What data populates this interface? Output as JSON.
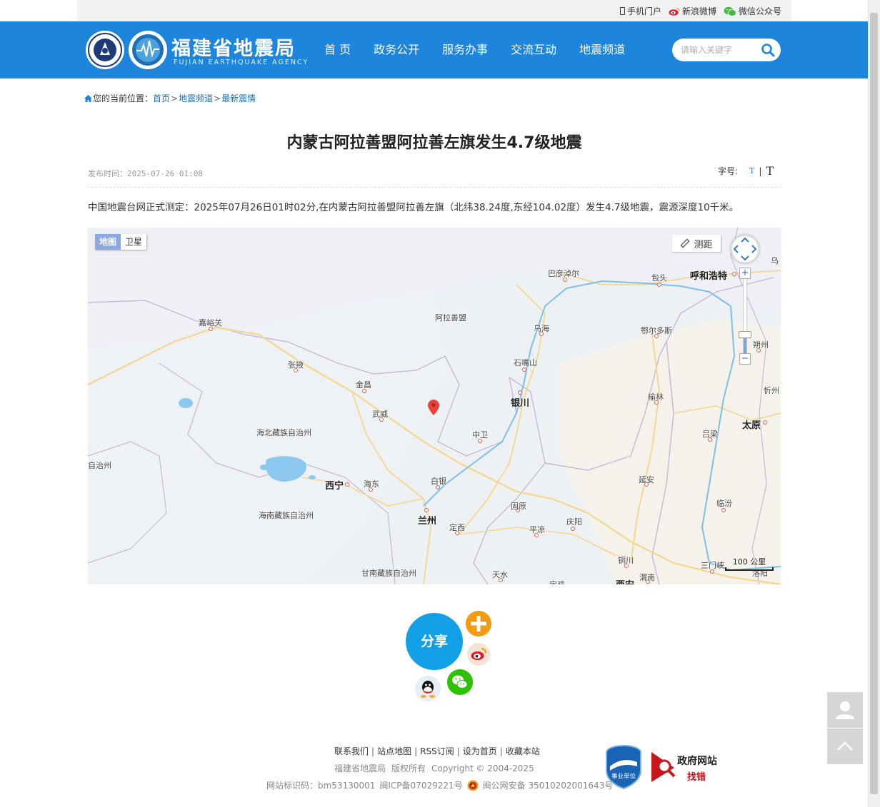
{
  "topbar": {
    "mobile": "手机门户",
    "weibo": "新浪微博",
    "wechat": "微信公众号"
  },
  "header": {
    "site_title": "福建省地震局",
    "site_subtitle": "FUJIAN EARTHQUAKE AGENCY",
    "nav": [
      {
        "label": "首 页"
      },
      {
        "label": "政务公开"
      },
      {
        "label": "服务办事"
      },
      {
        "label": "交流互动"
      },
      {
        "label": "地震频道"
      }
    ],
    "search_placeholder": "请输入关键字",
    "brand_color": "#1d85db"
  },
  "breadcrumb": {
    "prefix": "您的当前位置：",
    "items": [
      "首页",
      "地震频道",
      "最新震情"
    ],
    "separator": ">"
  },
  "article": {
    "title": "内蒙古阿拉善盟阿拉善左旗发生4.7级地震",
    "publish_label": "发布时间：",
    "publish_time": "2025-07-26 01:08",
    "fontsize_label": "字号:",
    "fontsize_small": "T",
    "fontsize_sep": "|",
    "fontsize_big": "T",
    "body": "中国地震台网正式测定：2025年07月26日01时02分,在内蒙古阿拉善盟阿拉善左旗（北纬38.24度,东经104.02度）发生4.7级地震，震源深度10千米。"
  },
  "map": {
    "type_map": "地图",
    "type_satellite": "卫星",
    "measure": "测距",
    "scale": "100 公里",
    "zoom_in": "+",
    "zoom_out": "−",
    "labels": {
      "bayannur": "巴彦淖尔",
      "baotou": "包头",
      "hohhot": "呼和浩特",
      "wu": "乌",
      "alxa": "阿拉善盟",
      "wuhai": "乌海",
      "ordos": "鄂尔多斯",
      "jiayuguan": "嘉峪关",
      "shuozhou": "朔州",
      "zhangye": "张掖",
      "shizuishan": "石嘴山",
      "jinchang": "金昌",
      "yulin": "榆林",
      "xinzhou": "忻州",
      "yinchuan": "银川",
      "wuwei": "武威",
      "taiyuan": "太原",
      "haibei": "海北藏族自治州",
      "zhongwei": "中卫",
      "lvliang": "吕梁",
      "zizhizhou": "自治州",
      "baiyin": "白银",
      "xining": "西宁",
      "haidong": "海东",
      "yanan": "延安",
      "guyuan": "固原",
      "linfen": "临汾",
      "hainan": "海南藏族自治州",
      "lanzhou": "兰州",
      "qingyang": "庆阳",
      "dingxi": "定西",
      "pingliang": "平凉",
      "tongchuan": "铜川",
      "sanmenxia": "三门峡",
      "gannan": "甘南藏族自治州",
      "tianshui": "天水",
      "weinan": "渭南",
      "luoyang": "洛阳",
      "baoji": "宝鸡",
      "xian": "西安"
    }
  },
  "share": {
    "label": "分享"
  },
  "footer": {
    "links": [
      "联系我们",
      "站点地图",
      "RSS订阅",
      "设为首页",
      "收藏本站"
    ],
    "org": "福建省地震局",
    "rights": "版权所有",
    "copyright": "Copyright © 2004-2025",
    "site_id": "网站标识码：bm53130001",
    "icp": "闽ICP备07029221号",
    "police": "闽公网安备 35010202001643号",
    "badge_text": "事业单位",
    "gov_line1": "政府网站",
    "gov_line2": "找错"
  }
}
